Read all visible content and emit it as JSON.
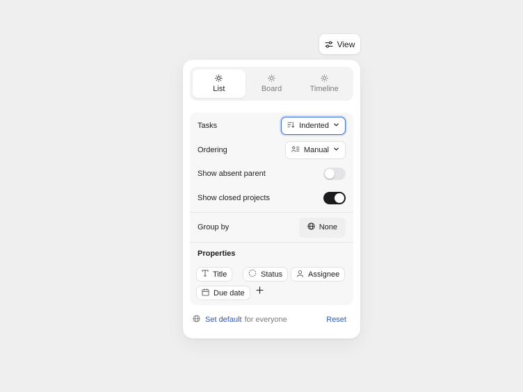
{
  "view_button": {
    "label": "View",
    "icon": "sliders-icon"
  },
  "tabs": [
    {
      "label": "List",
      "icon": "sun-icon",
      "active": true
    },
    {
      "label": "Board",
      "icon": "sun-icon",
      "active": false
    },
    {
      "label": "Timeline",
      "icon": "sun-icon",
      "active": false
    }
  ],
  "settings": {
    "tasks": {
      "label": "Tasks",
      "value": "Indented",
      "icon": "sort-indent-icon"
    },
    "ordering": {
      "label": "Ordering",
      "value": "Manual",
      "icon": "person-list-icon"
    },
    "show_absent_parent": {
      "label": "Show absent parent",
      "on": false
    },
    "show_closed_projects": {
      "label": "Show closed projects",
      "on": true
    },
    "group_by": {
      "label": "Group by",
      "value": "None",
      "icon": "globe-icon"
    }
  },
  "properties": {
    "title": "Properties",
    "chips": [
      {
        "label": "Title",
        "icon": "text-icon"
      },
      {
        "label": "Status",
        "icon": "dashed-circle-icon"
      },
      {
        "label": "Assignee",
        "icon": "user-icon"
      },
      {
        "label": "Due date",
        "icon": "calendar-icon"
      }
    ]
  },
  "footer": {
    "link": "Set default",
    "suffix": "for everyone",
    "reset": "Reset"
  },
  "colors": {
    "accent": "#2a57c4",
    "focus_border": "#3d6fd6",
    "toggle_on": "#1c1c1e",
    "toggle_off": "#e4e4e6"
  }
}
